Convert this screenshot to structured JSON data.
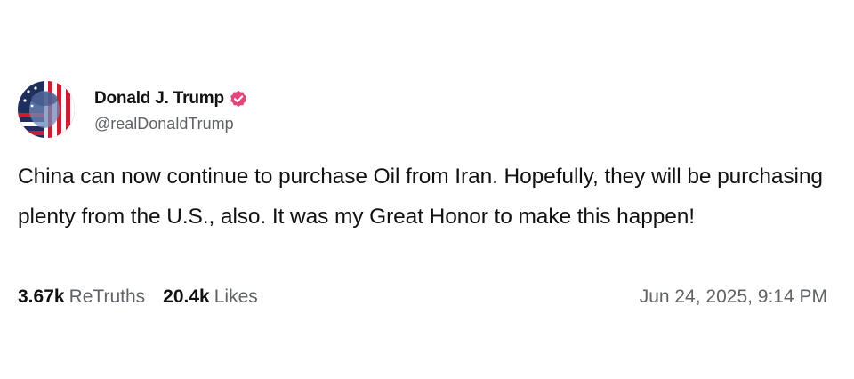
{
  "author": {
    "display_name": "Donald J. Trump",
    "handle": "@realDonaldTrump",
    "verified_icon": "verified-badge-icon",
    "verified_color": "#e0457b"
  },
  "post": {
    "text": "China can now continue to purchase Oil from Iran. Hopefully, they will be purchasing plenty from the U.S., also. It was my Great Honor to make this happen!"
  },
  "stats": {
    "retruths_count": "3.67k",
    "retruths_label": "ReTruths",
    "likes_count": "20.4k",
    "likes_label": "Likes"
  },
  "timestamp": "Jun 24, 2025, 9:14 PM"
}
